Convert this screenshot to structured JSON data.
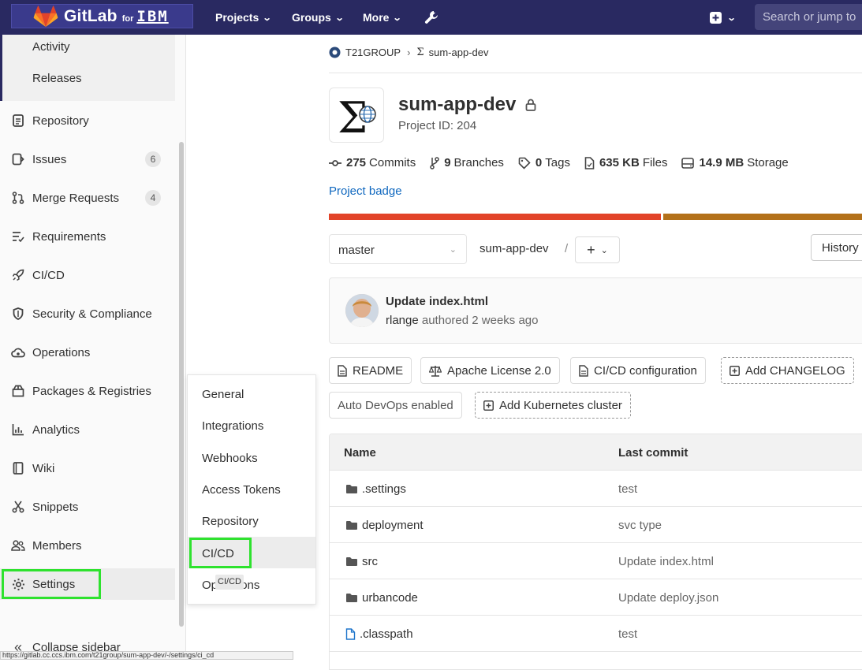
{
  "topbar": {
    "logo_text": "GitLab",
    "logo_for": "for",
    "logo_brand": "IBM",
    "nav": [
      "Projects",
      "Groups",
      "More"
    ],
    "search_placeholder": "Search or jump to"
  },
  "sidebar": {
    "sub_items": [
      "Activity",
      "Releases"
    ],
    "items": [
      {
        "label": "Repository",
        "icon": "doc-icon"
      },
      {
        "label": "Issues",
        "icon": "issues-icon",
        "count": "6"
      },
      {
        "label": "Merge Requests",
        "icon": "merge-request-icon",
        "count": "4"
      },
      {
        "label": "Requirements",
        "icon": "requirements-icon"
      },
      {
        "label": "CI/CD",
        "icon": "rocket-icon"
      },
      {
        "label": "Security & Compliance",
        "icon": "shield-icon"
      },
      {
        "label": "Operations",
        "icon": "cloud-gear-icon"
      },
      {
        "label": "Packages & Registries",
        "icon": "package-icon"
      },
      {
        "label": "Analytics",
        "icon": "chart-icon"
      },
      {
        "label": "Wiki",
        "icon": "book-icon"
      },
      {
        "label": "Snippets",
        "icon": "scissors-icon"
      },
      {
        "label": "Members",
        "icon": "users-icon"
      },
      {
        "label": "Settings",
        "icon": "gear-icon"
      }
    ],
    "collapse_label": "Collapse sidebar"
  },
  "flyout": {
    "items": [
      "General",
      "Integrations",
      "Webhooks",
      "Access Tokens",
      "Repository",
      "CI/CD",
      "Operations"
    ],
    "tooltip": "CI/CD"
  },
  "statusbar": {
    "url": "https://gitlab.cc.ccs.ibm.com/t21group/sum-app-dev/-/settings/ci_cd"
  },
  "breadcrumb": {
    "group": "T21GROUP",
    "project": "sum-app-dev"
  },
  "project": {
    "name": "sum-app-dev",
    "id_label": "Project ID: 204"
  },
  "stats": [
    {
      "value": "275",
      "label": "Commits",
      "icon": "commit-icon"
    },
    {
      "value": "9",
      "label": "Branches",
      "icon": "branch-icon"
    },
    {
      "value": "0",
      "label": "Tags",
      "icon": "tag-icon"
    },
    {
      "value": "635 KB",
      "label": "Files",
      "icon": "file-icon"
    },
    {
      "value": "14.9 MB",
      "label": "Storage",
      "icon": "storage-icon"
    }
  ],
  "badge_link": "Project badge",
  "repo": {
    "branch": "master",
    "path": "sum-app-dev",
    "slash": "/",
    "history": "History"
  },
  "commit": {
    "title": "Update index.html",
    "author": "rlange",
    "meta": "authored 2 weeks ago"
  },
  "buttons": {
    "readme": "README",
    "license": "Apache License 2.0",
    "cicd_config": "CI/CD configuration",
    "changelog": "Add CHANGELOG",
    "autodevops": "Auto DevOps enabled",
    "kubernetes": "Add Kubernetes cluster"
  },
  "table": {
    "headers": [
      "Name",
      "Last commit"
    ],
    "rows": [
      {
        "name": ".settings",
        "commit": "test",
        "type": "folder"
      },
      {
        "name": "deployment",
        "commit": "svc type",
        "type": "folder"
      },
      {
        "name": "src",
        "commit": "Update index.html",
        "type": "folder"
      },
      {
        "name": "urbancode",
        "commit": "Update deploy.json",
        "type": "folder"
      },
      {
        "name": ".classpath",
        "commit": "test",
        "type": "file"
      }
    ]
  },
  "colors": {
    "topbar": "#292961",
    "link": "#1068bf",
    "highlight": "#2ee22e",
    "language_bar_primary": "#e24329",
    "language_bar_secondary": "#b3711a"
  }
}
